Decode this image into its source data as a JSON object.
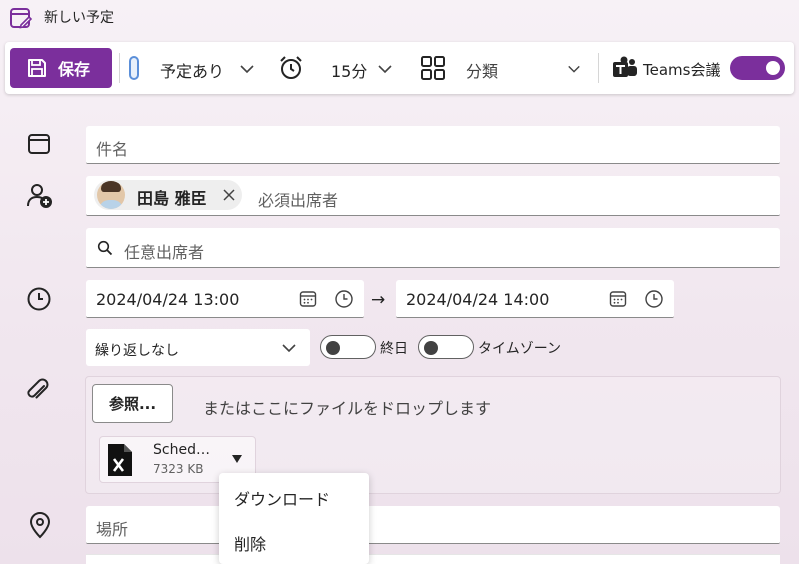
{
  "window": {
    "title": "新しい予定"
  },
  "toolbar": {
    "save_label": "保存",
    "show_as": "予定あり",
    "reminder": "15分",
    "category": "分類",
    "teams_label": "Teams会議",
    "teams_enabled": true
  },
  "form": {
    "title_placeholder": "件名",
    "required_attendee": {
      "name": "田島 雅臣"
    },
    "required_placeholder": "必須出席者",
    "optional_placeholder": "任意出席者",
    "start": "2024/04/24 13:00",
    "end": "2024/04/24 14:00",
    "arrow": "→",
    "recurrence": "繰り返しなし",
    "all_day_label": "終日",
    "all_day_enabled": false,
    "timezone_label": "タイムゾーン",
    "timezone_enabled": false,
    "browse_label": "参照...",
    "drop_hint": "またはここにファイルをドロップします",
    "attachment": {
      "name": "Sched…",
      "size": "7323 KB"
    },
    "location_placeholder": "場所"
  },
  "attachment_menu": {
    "items": [
      {
        "label": "ダウンロード"
      },
      {
        "label": "削除"
      }
    ]
  },
  "colors": {
    "accent": "#7b2f9c",
    "toggle_on": "#7b2f9c"
  }
}
